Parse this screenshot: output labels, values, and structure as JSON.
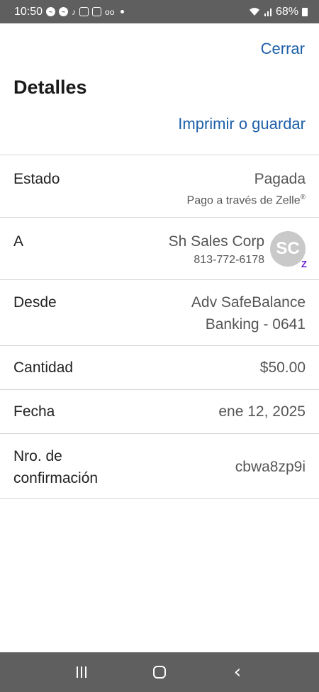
{
  "status_bar": {
    "time": "10:50",
    "battery": "68%",
    "notification_icons": [
      "messenger-icon",
      "messenger-icon",
      "tiktok-icon",
      "instagram-icon",
      "instagram-icon",
      "voicemail-icon",
      "dot-icon"
    ],
    "system_icons": [
      "wifi-icon",
      "signal-icon",
      "battery-icon"
    ]
  },
  "header": {
    "close_label": "Cerrar",
    "title": "Detalles",
    "print_label": "Imprimir o guardar"
  },
  "details": {
    "estado": {
      "label": "Estado",
      "value": "Pagada",
      "sub": "Pago a través de Zelle",
      "sub_mark": "®"
    },
    "a": {
      "label": "A",
      "name": "Sh Sales Corp",
      "phone": "813-772-6178",
      "initials": "SC",
      "badge": "Z"
    },
    "desde": {
      "label": "Desde",
      "line1": "Adv SafeBalance",
      "line2": "Banking - 0641"
    },
    "cantidad": {
      "label": "Cantidad",
      "value": "$50.00"
    },
    "fecha": {
      "label": "Fecha",
      "value": "ene 12, 2025"
    },
    "confirmacion": {
      "label_line1": "Nro. de",
      "label_line2": "confirmación",
      "value": "cbwa8zp9i"
    }
  },
  "colors": {
    "link": "#1d5fa8",
    "system_bar": "#5f5f5f",
    "zelle_purple": "#6d1ed4"
  }
}
